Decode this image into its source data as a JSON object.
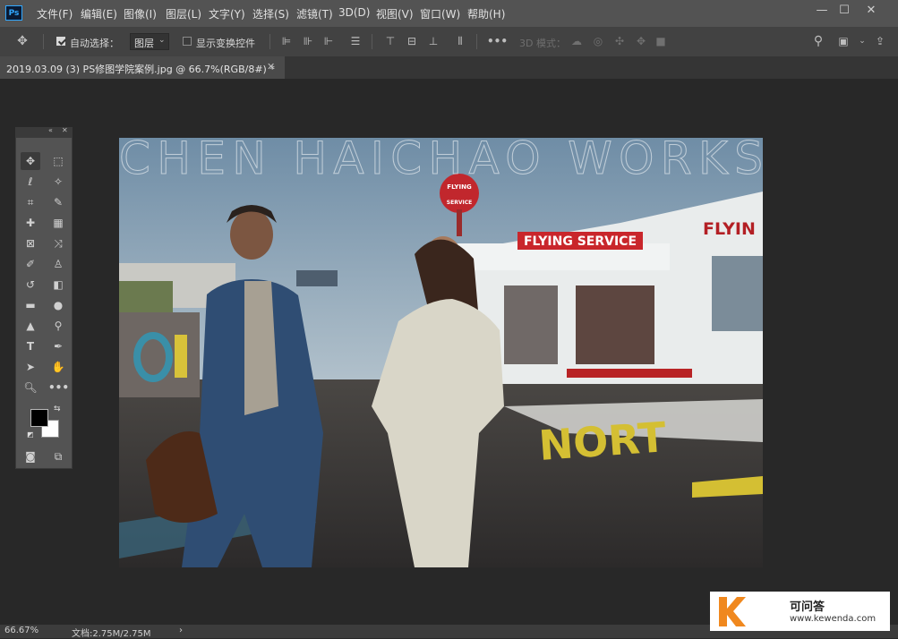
{
  "app": {
    "logo": "Ps"
  },
  "menu": [
    "文件(F)",
    "编辑(E)",
    "图像(I)",
    "图层(L)",
    "文字(Y)",
    "选择(S)",
    "滤镜(T)",
    "3D(D)",
    "视图(V)",
    "窗口(W)",
    "帮助(H)"
  ],
  "window_controls": {
    "minimize": "—",
    "maximize": "☐",
    "close": "✕"
  },
  "options": {
    "auto_select_label": "自动选择：",
    "auto_select_checked": true,
    "layer_dropdown": "图层",
    "show_transform_label": "显示变换控件",
    "show_transform_checked": false,
    "mode_3d_label": "3D 模式："
  },
  "document": {
    "tab_title": "2019.03.09  (3)  PS修图学院案例.jpg @ 66.7%(RGB/8#) *",
    "close": "✕"
  },
  "photo": {
    "watermark_text": "CHEN HAICHAO WORKS",
    "sign_line1": "FLYING",
    "sign_line2": "SERVICE",
    "banner": "FLYING SERVICE",
    "building_letters": "FLYIN",
    "ground_text": "NORT"
  },
  "tools": [
    "move-icon",
    "marquee-icon",
    "lasso-icon",
    "magic-wand-icon",
    "crop-icon",
    "eyedropper-icon",
    "healing-icon",
    "brush-icon",
    "stamp-icon",
    "history-brush-icon",
    "eraser-icon",
    "gradient-icon",
    "blur-icon",
    "dodge-icon",
    "pen-icon",
    "type-icon",
    "path-select-icon",
    "shape-icon",
    "hand-icon",
    "zoom-icon",
    "more-icon"
  ],
  "colors": {
    "foreground": "#000000",
    "background": "#ffffff",
    "chrome": "#535353",
    "canvas_bg": "#282828"
  },
  "status": {
    "zoom": "66.67%",
    "doc_size": "文档:2.75M/2.75M",
    "arrow": "›"
  },
  "watermark": {
    "name": "可问答",
    "url": "www.kewenda.com"
  }
}
